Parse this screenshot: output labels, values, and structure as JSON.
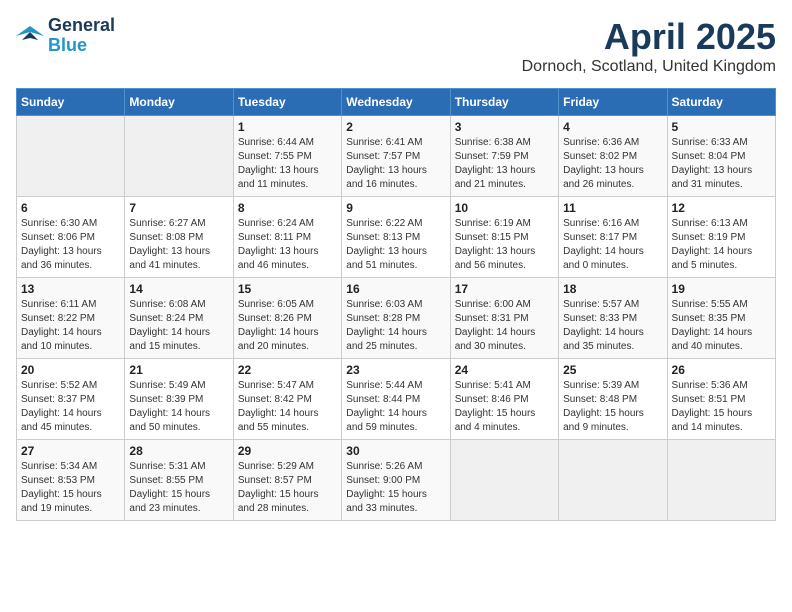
{
  "logo": {
    "line1": "General",
    "line2": "Blue"
  },
  "title": "April 2025",
  "subtitle": "Dornoch, Scotland, United Kingdom",
  "days_of_week": [
    "Sunday",
    "Monday",
    "Tuesday",
    "Wednesday",
    "Thursday",
    "Friday",
    "Saturday"
  ],
  "weeks": [
    [
      {
        "day": "",
        "info": ""
      },
      {
        "day": "",
        "info": ""
      },
      {
        "day": "1",
        "info": "Sunrise: 6:44 AM\nSunset: 7:55 PM\nDaylight: 13 hours and 11 minutes."
      },
      {
        "day": "2",
        "info": "Sunrise: 6:41 AM\nSunset: 7:57 PM\nDaylight: 13 hours and 16 minutes."
      },
      {
        "day": "3",
        "info": "Sunrise: 6:38 AM\nSunset: 7:59 PM\nDaylight: 13 hours and 21 minutes."
      },
      {
        "day": "4",
        "info": "Sunrise: 6:36 AM\nSunset: 8:02 PM\nDaylight: 13 hours and 26 minutes."
      },
      {
        "day": "5",
        "info": "Sunrise: 6:33 AM\nSunset: 8:04 PM\nDaylight: 13 hours and 31 minutes."
      }
    ],
    [
      {
        "day": "6",
        "info": "Sunrise: 6:30 AM\nSunset: 8:06 PM\nDaylight: 13 hours and 36 minutes."
      },
      {
        "day": "7",
        "info": "Sunrise: 6:27 AM\nSunset: 8:08 PM\nDaylight: 13 hours and 41 minutes."
      },
      {
        "day": "8",
        "info": "Sunrise: 6:24 AM\nSunset: 8:11 PM\nDaylight: 13 hours and 46 minutes."
      },
      {
        "day": "9",
        "info": "Sunrise: 6:22 AM\nSunset: 8:13 PM\nDaylight: 13 hours and 51 minutes."
      },
      {
        "day": "10",
        "info": "Sunrise: 6:19 AM\nSunset: 8:15 PM\nDaylight: 13 hours and 56 minutes."
      },
      {
        "day": "11",
        "info": "Sunrise: 6:16 AM\nSunset: 8:17 PM\nDaylight: 14 hours and 0 minutes."
      },
      {
        "day": "12",
        "info": "Sunrise: 6:13 AM\nSunset: 8:19 PM\nDaylight: 14 hours and 5 minutes."
      }
    ],
    [
      {
        "day": "13",
        "info": "Sunrise: 6:11 AM\nSunset: 8:22 PM\nDaylight: 14 hours and 10 minutes."
      },
      {
        "day": "14",
        "info": "Sunrise: 6:08 AM\nSunset: 8:24 PM\nDaylight: 14 hours and 15 minutes."
      },
      {
        "day": "15",
        "info": "Sunrise: 6:05 AM\nSunset: 8:26 PM\nDaylight: 14 hours and 20 minutes."
      },
      {
        "day": "16",
        "info": "Sunrise: 6:03 AM\nSunset: 8:28 PM\nDaylight: 14 hours and 25 minutes."
      },
      {
        "day": "17",
        "info": "Sunrise: 6:00 AM\nSunset: 8:31 PM\nDaylight: 14 hours and 30 minutes."
      },
      {
        "day": "18",
        "info": "Sunrise: 5:57 AM\nSunset: 8:33 PM\nDaylight: 14 hours and 35 minutes."
      },
      {
        "day": "19",
        "info": "Sunrise: 5:55 AM\nSunset: 8:35 PM\nDaylight: 14 hours and 40 minutes."
      }
    ],
    [
      {
        "day": "20",
        "info": "Sunrise: 5:52 AM\nSunset: 8:37 PM\nDaylight: 14 hours and 45 minutes."
      },
      {
        "day": "21",
        "info": "Sunrise: 5:49 AM\nSunset: 8:39 PM\nDaylight: 14 hours and 50 minutes."
      },
      {
        "day": "22",
        "info": "Sunrise: 5:47 AM\nSunset: 8:42 PM\nDaylight: 14 hours and 55 minutes."
      },
      {
        "day": "23",
        "info": "Sunrise: 5:44 AM\nSunset: 8:44 PM\nDaylight: 14 hours and 59 minutes."
      },
      {
        "day": "24",
        "info": "Sunrise: 5:41 AM\nSunset: 8:46 PM\nDaylight: 15 hours and 4 minutes."
      },
      {
        "day": "25",
        "info": "Sunrise: 5:39 AM\nSunset: 8:48 PM\nDaylight: 15 hours and 9 minutes."
      },
      {
        "day": "26",
        "info": "Sunrise: 5:36 AM\nSunset: 8:51 PM\nDaylight: 15 hours and 14 minutes."
      }
    ],
    [
      {
        "day": "27",
        "info": "Sunrise: 5:34 AM\nSunset: 8:53 PM\nDaylight: 15 hours and 19 minutes."
      },
      {
        "day": "28",
        "info": "Sunrise: 5:31 AM\nSunset: 8:55 PM\nDaylight: 15 hours and 23 minutes."
      },
      {
        "day": "29",
        "info": "Sunrise: 5:29 AM\nSunset: 8:57 PM\nDaylight: 15 hours and 28 minutes."
      },
      {
        "day": "30",
        "info": "Sunrise: 5:26 AM\nSunset: 9:00 PM\nDaylight: 15 hours and 33 minutes."
      },
      {
        "day": "",
        "info": ""
      },
      {
        "day": "",
        "info": ""
      },
      {
        "day": "",
        "info": ""
      }
    ]
  ]
}
